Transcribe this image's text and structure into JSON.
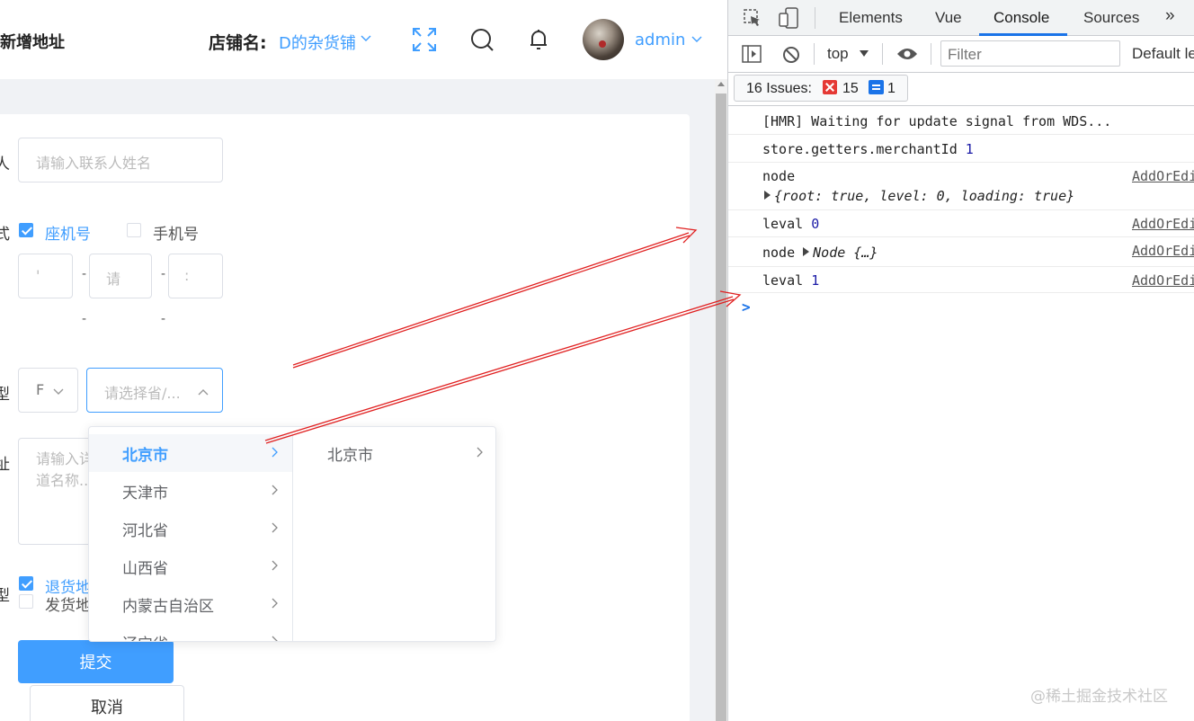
{
  "header": {
    "page_title": "新增地址",
    "store_label": "店铺名:",
    "store_name": "D的杂货铺",
    "admin_name": "admin"
  },
  "form": {
    "contact_label_fragment": "人",
    "contact_placeholder": "请输入联系人姓名",
    "contact_method_label_fragment": "式",
    "landline_label": "座机号",
    "mobile_label": "手机号",
    "phone_part1_placeholder": "'",
    "phone_part2_placeholder": "请",
    "phone_part3_placeholder": ":",
    "phone_dash": "-",
    "region_label_fragment": "型",
    "region_type_value": "F",
    "region_placeholder": "请选择省/...",
    "address_label_fragment": "址",
    "address_placeholder_line1": "请输入详",
    "address_placeholder_line2": "道名称...",
    "address_type_label_fragment": "型",
    "return_address_label": "退货地址",
    "ship_address_label": "发货地址",
    "submit_label": "提交",
    "cancel_label": "取消"
  },
  "cascader": {
    "level1": [
      "北京市",
      "天津市",
      "河北省",
      "山西省",
      "内蒙古自治区",
      "辽宁省"
    ],
    "level1_active_index": 0,
    "level2": [
      "北京市"
    ]
  },
  "devtools": {
    "tabs": [
      "Elements",
      "Vue",
      "Console",
      "Sources"
    ],
    "active_tab": "Console",
    "more_tabs": "»",
    "context": "top",
    "filter_placeholder": "Filter",
    "levels_label": "Default levels",
    "issues_label": "16 Issues:",
    "issues_errors": "15",
    "issues_messages": "1",
    "console_lines": [
      {
        "text": "[HMR] Waiting for update signal from WDS...",
        "source": ""
      },
      {
        "text": "store.getters.merchantId",
        "value": "1",
        "source": ""
      },
      {
        "text": "node",
        "object": "{root: true, level: 0, loading: true}",
        "source": "AddOrEdit"
      },
      {
        "text": "leval",
        "value": "0",
        "source": "AddOrEdit"
      },
      {
        "text": "node",
        "object": "Node {…}",
        "source": "AddOrEdit"
      },
      {
        "text": "leval",
        "value": "1",
        "source": "AddOrEdit"
      }
    ],
    "prompt": ">"
  },
  "watermark": "@稀土掘金技术社区",
  "colors": {
    "accent": "#409eff",
    "annotation_arrow": "#e02020",
    "devtools_blue": "#1a73e8",
    "error_red": "#e53935"
  }
}
